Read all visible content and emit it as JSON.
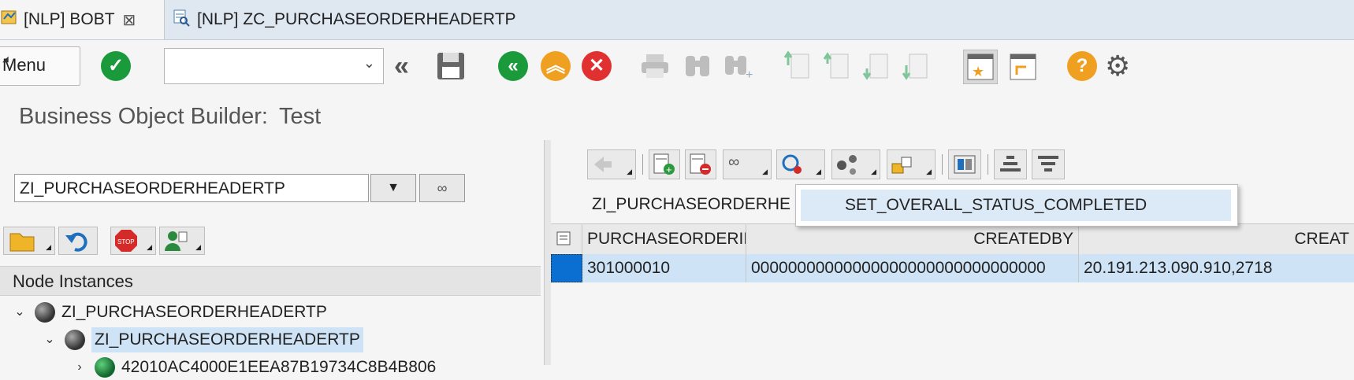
{
  "tabs": [
    {
      "label": "[NLP] BOBT",
      "close": "⊠"
    },
    {
      "label": "[NLP] ZC_PURCHASEORDERHEADERTP"
    }
  ],
  "toolbar": {
    "menu_label": "Menu",
    "command_field_value": "",
    "icons": [
      "enter-icon",
      "back-double-icon",
      "save-icon",
      "back-icon",
      "exit-icon",
      "cancel-icon",
      "print-icon",
      "find-icon",
      "find-next-icon",
      "first-page-icon",
      "previous-page-icon",
      "next-page-icon",
      "last-page-icon",
      "create-session-icon",
      "shortcut-icon",
      "help-icon",
      "settings-icon"
    ]
  },
  "header": {
    "title": "Business Object Builder:",
    "subtitle": "Test"
  },
  "left_pane": {
    "object_name": "ZI_PURCHASEORDERHEADERTP",
    "node_instances_label": "Node Instances",
    "tree": [
      {
        "level": 0,
        "label": "ZI_PURCHASEORDERHEADERTP"
      },
      {
        "level": 1,
        "label": "ZI_PURCHASEORDERHEADERTP"
      },
      {
        "level": 2,
        "label": "42010AC4000E1EEA87B19734C8B4B806"
      }
    ]
  },
  "right_pane": {
    "table_title": "ZI_PURCHASEORDERHE",
    "context_menu": {
      "item": "SET_OVERALL_STATUS_COMPLETED"
    },
    "columns": [
      "PURCHASEORDERID",
      "CREATEDBY",
      "CREAT"
    ],
    "rows": [
      [
        "301000010",
        "00000000000000000000000000000000",
        "20.191.213.090.910,2718"
      ]
    ]
  },
  "colors": {
    "enter_green": "#1a9a3a",
    "nav_green": "#1a9a3a",
    "nav_orange": "#f0a020",
    "nav_red": "#e03030",
    "help_orange": "#f0a020",
    "selection_blue": "#cfe3f6"
  }
}
